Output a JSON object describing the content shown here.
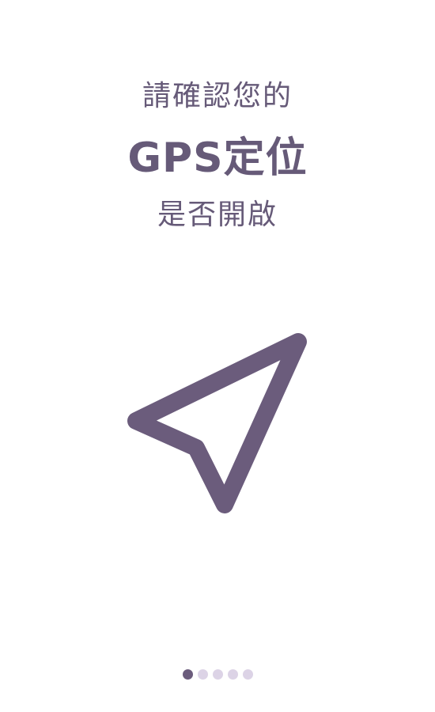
{
  "onboarding": {
    "line1": "請確認您的",
    "line2": "GPS定位",
    "line3": "是否開啟",
    "icon": "navigation-arrow-icon"
  },
  "pager": {
    "total": 5,
    "active_index": 0
  },
  "colors": {
    "text": "#665a78",
    "icon": "#6b5c7c",
    "dot_active": "#6b5c7c",
    "dot_inactive": "#dcd3e6",
    "background": "#ffffff"
  }
}
